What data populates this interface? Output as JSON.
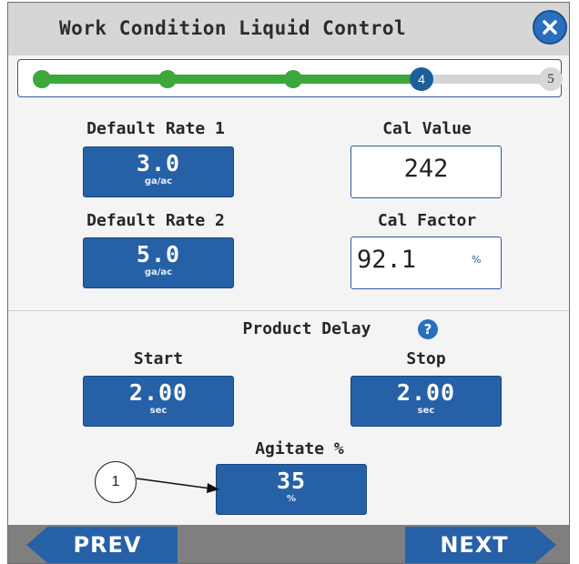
{
  "window": {
    "title": "Work Condition Liquid Control"
  },
  "progress": {
    "current_step": "4",
    "next_step": "5",
    "fraction_complete": 0.78
  },
  "default_rate_1": {
    "label": "Default Rate 1",
    "value": "3.0",
    "unit": "ga/ac"
  },
  "default_rate_2": {
    "label": "Default Rate 2",
    "value": "5.0",
    "unit": "ga/ac"
  },
  "cal_value": {
    "label": "Cal Value",
    "value": "242"
  },
  "cal_factor": {
    "label": "Cal Factor",
    "value": "92.1",
    "unit": "%"
  },
  "product_delay": {
    "title": "Product Delay",
    "help_symbol": "?",
    "start": {
      "label": "Start",
      "value": "2.00",
      "unit": "sec"
    },
    "stop": {
      "label": "Stop",
      "value": "2.00",
      "unit": "sec"
    }
  },
  "agitate": {
    "label": "Agitate %",
    "value": "35",
    "unit": "%"
  },
  "callout": {
    "number": "1"
  },
  "nav": {
    "prev_label": "PREV",
    "next_label": "NEXT"
  },
  "colors": {
    "accent": "#2661a8",
    "progress": "#3aa83a",
    "title_bar": "#d6d6d6"
  },
  "icons": {
    "close": "close-icon",
    "help": "help-icon"
  }
}
